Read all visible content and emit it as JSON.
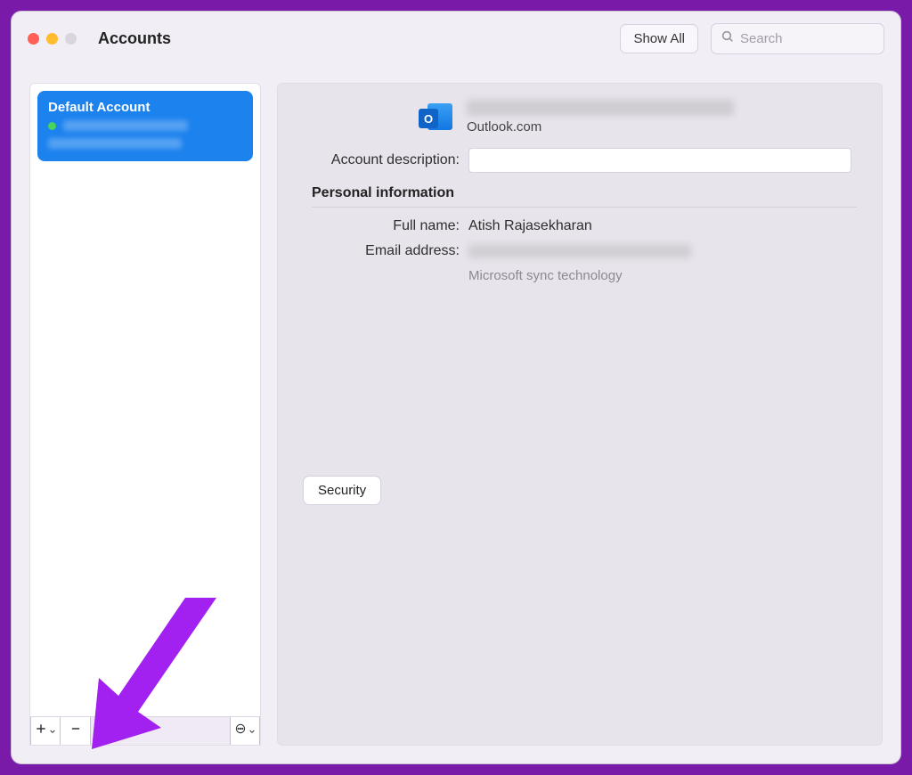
{
  "window": {
    "title": "Accounts",
    "show_all_label": "Show All",
    "search_placeholder": "Search"
  },
  "sidebar": {
    "selected": {
      "title": "Default Account",
      "status": "online"
    },
    "footer": {
      "add_tooltip": "Add account",
      "remove_tooltip": "Remove account",
      "more_tooltip": "More options"
    }
  },
  "detail": {
    "service_name": "Outlook.com",
    "labels": {
      "account_description": "Account description:",
      "personal_info": "Personal information",
      "full_name": "Full name:",
      "email": "Email address:"
    },
    "full_name_value": "Atish Rajasekharan",
    "sync_note": "Microsoft sync technology",
    "security_button": "Security"
  },
  "annotation": {
    "arrow_color": "#a221f0"
  }
}
